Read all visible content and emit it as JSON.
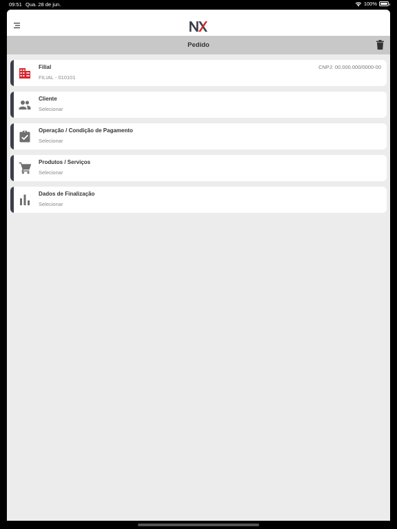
{
  "status": {
    "time": "09:51",
    "date": "Qua. 28 de jun.",
    "battery": "100%"
  },
  "header": {
    "logo": "NX"
  },
  "subheader": {
    "title": "Pedido"
  },
  "cards": [
    {
      "title": "Filial",
      "subtitle": "FILIAL - 010101",
      "right": "CNPJ: 00.000.000/0000-00",
      "icon": "building-icon"
    },
    {
      "title": "Cliente",
      "subtitle": "Selecionar",
      "icon": "people-icon"
    },
    {
      "title": "Operação / Condição de Pagamento",
      "subtitle": "Selecionar",
      "icon": "clipboard-check-icon"
    },
    {
      "title": "Produtos / Serviços",
      "subtitle": "Selecionar",
      "icon": "cart-icon"
    },
    {
      "title": "Dados de Finalização",
      "subtitle": "Selecionar",
      "icon": "bar-chart-icon"
    }
  ],
  "colors": {
    "accent": "#d7262d",
    "dark": "#3b3f4a",
    "icon_gray": "#6f6f6f",
    "background": "#ececec"
  }
}
